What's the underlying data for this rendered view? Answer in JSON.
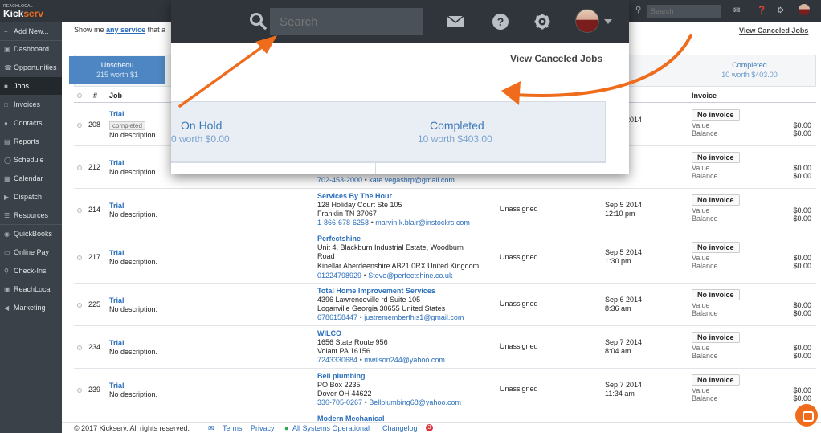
{
  "app": {
    "logo_small": "REACHLOCAL",
    "logo_prefix": "Kick",
    "logo_suffix": "serv",
    "search_placeholder": "Search"
  },
  "sidebar": {
    "items": [
      {
        "label": "Add New...",
        "icon": "plus-icon"
      },
      {
        "label": "Dashboard",
        "icon": "dashboard-icon"
      },
      {
        "label": "Opportunities",
        "icon": "phone-icon"
      },
      {
        "label": "Jobs",
        "icon": "briefcase-icon"
      },
      {
        "label": "Invoices",
        "icon": "document-icon"
      },
      {
        "label": "Contacts",
        "icon": "people-icon"
      },
      {
        "label": "Reports",
        "icon": "chart-icon"
      },
      {
        "label": "Schedule",
        "icon": "globe-icon"
      },
      {
        "label": "Calendar",
        "icon": "calendar-icon"
      },
      {
        "label": "Dispatch",
        "icon": "truck-icon"
      },
      {
        "label": "Resources",
        "icon": "list-icon"
      },
      {
        "label": "QuickBooks",
        "icon": "quickbooks-icon"
      },
      {
        "label": "Online Pay",
        "icon": "card-icon"
      },
      {
        "label": "Check-Ins",
        "icon": "pin-icon"
      },
      {
        "label": "ReachLocal",
        "icon": "reachlocal-icon"
      },
      {
        "label": "Marketing",
        "icon": "megaphone-icon"
      }
    ]
  },
  "main": {
    "show_me_prefix": "Show me",
    "show_me_link": "any service",
    "show_me_suffix": "that a",
    "view_canceled": "View Canceled Jobs",
    "tab_unscheduled_label": "Unschedu",
    "tab_unscheduled_sub": "215 worth $1",
    "tab_completed_label": "Completed",
    "tab_completed_sub": "10 worth $403.00",
    "columns": {
      "num": "#",
      "job": "Job",
      "invoice": "Invoice"
    }
  },
  "rows": [
    {
      "num": "208",
      "title": "Trial",
      "badge": "completed",
      "desc": "No description.",
      "inv": "No invoice",
      "v1": "$0.00",
      "v2": "$0.00"
    },
    {
      "num": "212",
      "title": "Trial",
      "desc": "No description.",
      "contact_phone": "702-453-2000",
      "contact_email": "kate.vegashrp@gmail.com",
      "inv": "No invoice",
      "v1": "$0.00",
      "v2": "$0.00"
    },
    {
      "num": "214",
      "title": "Trial",
      "desc": "No description.",
      "customer": "Services By The Hour",
      "addr1": "128 Holiday Court Ste 105",
      "addr2": "Franklin TN 37067",
      "phone": "1-866-678-6258",
      "email": "marvin.k.blair@instockrs.com",
      "tech": "Unassigned",
      "date": "Sep 5 2014",
      "time": "12:10 pm",
      "inv": "No invoice",
      "v1": "$0.00",
      "v2": "$0.00"
    },
    {
      "num": "217",
      "title": "Trial",
      "desc": "No description.",
      "customer": "Perfectshine",
      "addr1": "Unit 4, Blackburn Industrial Estate, Woodburn",
      "addr2": "Road",
      "addr3": "Kinellar Aberdeenshire AB21 0RX United Kingdom",
      "phone": "01224798929",
      "email": "Steve@perfectshine.co.uk",
      "tech": "Unassigned",
      "date": "Sep 5 2014",
      "time": "1:30 pm",
      "inv": "No invoice",
      "v1": "$0.00",
      "v2": "$0.00"
    },
    {
      "num": "225",
      "title": "Trial",
      "desc": "No description.",
      "customer": "Total Home Improvement Services",
      "addr1": "4396 Lawrenceville rd Suite 105",
      "addr2": "Loganville Georgia 30655 United States",
      "phone": "6786158447",
      "email": "justrememberthis1@gmail.com",
      "tech": "Unassigned",
      "date": "Sep 6 2014",
      "time": "8:36 am",
      "inv": "No invoice",
      "v1": "$0.00",
      "v2": "$0.00"
    },
    {
      "num": "234",
      "title": "Trial",
      "desc": "No description.",
      "customer": "WILCO",
      "addr1": "1656 State Route 956",
      "addr2": "Volant PA 16156",
      "phone": "7243330684",
      "email": "mwilson244@yahoo.com",
      "tech": "Unassigned",
      "date": "Sep 7 2014",
      "time": "8:04 am",
      "inv": "No invoice",
      "v1": "$0.00",
      "v2": "$0.00"
    },
    {
      "num": "239",
      "title": "Trial",
      "desc": "No description.",
      "customer": "Bell plumbing",
      "addr1": "PO Box 2235",
      "addr2": "Dover OH 44622",
      "phone": "330-705-0267",
      "email": "Bellplumbing68@yahoo.com",
      "tech": "Unassigned",
      "date": "Sep 7 2014",
      "time": "11:34 am",
      "inv": "No invoice",
      "v1": "$0.00",
      "v2": "$0.00"
    },
    {
      "customer": "Modern Mechanical"
    }
  ],
  "labels": {
    "value": "Value",
    "balance": "Balance",
    "bullet": "•"
  },
  "date_partial": {
    "r208_date": "Sep 3 2014",
    "r208_time": "m",
    "r212_date": "014"
  },
  "footer": {
    "copyright": "© 2017 Kickserv. All rights reserved.",
    "terms": "Terms",
    "privacy": "Privacy",
    "status": "All Systems Operational",
    "changelog": "Changelog",
    "changelog_count": "3"
  },
  "zoom": {
    "search_placeholder": "Search",
    "view_canceled": "View Canceled Jobs",
    "on_hold": "On Hold",
    "on_hold_sub": "0 worth $0.00",
    "completed": "Completed",
    "completed_sub": "10 worth $403.00"
  },
  "colors": {
    "accent": "#ef6c1c",
    "link": "#2a6ebb",
    "sidebar": "#3a4148",
    "topbar": "#2f353b"
  }
}
